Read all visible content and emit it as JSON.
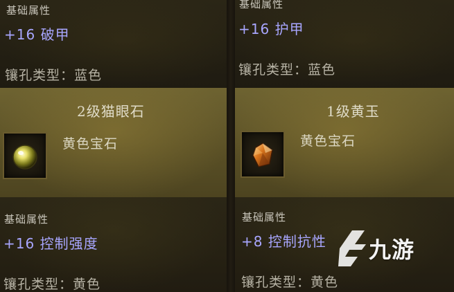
{
  "left": {
    "top_label": "基础属性",
    "top_stat": "+16 破甲",
    "top_socket": "镶孔类型：蓝色",
    "gem_title": "2级猫眼石",
    "gem_icon": "cat-eye-gem-icon",
    "gem_type": "黄色宝石",
    "bottom_label": "基础属性",
    "bottom_stat": "+16 控制强度",
    "bottom_socket": "镶孔类型：黄色"
  },
  "right": {
    "top_label": "基础属性",
    "top_stat": "+16 护甲",
    "top_socket": "镶孔类型：蓝色",
    "gem_title": "1级黄玉",
    "gem_icon": "topaz-gem-icon",
    "gem_type": "黄色宝石",
    "bottom_label": "基础属性",
    "bottom_stat": "+8 控制抗性",
    "bottom_socket": "镶孔类型：黄色"
  },
  "watermark": {
    "text": "九游",
    "icon": "jiuyou-logo-icon"
  },
  "colors": {
    "stat_text": "#a8a6ff",
    "header_bg": "#5a5026",
    "panel_bg": "#262113"
  }
}
